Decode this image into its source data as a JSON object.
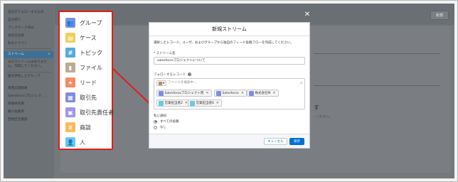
{
  "sidebar": {
    "items": [
      {
        "label": "自分がフォローするもの"
      },
      {
        "label": "自分宛て"
      },
      {
        "label": "ブックマーク済み"
      },
      {
        "label": "会社の注目"
      },
      {
        "label": "私のドラフト"
      },
      {
        "label": "ストリーム"
      },
      {
        "label": "まだストリームはありません。作成してください。"
      },
      {
        "label": "最近参照したグループ"
      },
      {
        "label": "東西応援販路"
      },
      {
        "label": "Salesforceプロジェク..."
      },
      {
        "label": "情報共有用"
      },
      {
        "label": "職人販路用"
      },
      {
        "label": "西地区営業部"
      }
    ]
  },
  "background": {
    "new_button": "新規",
    "right_text_big": "す",
    "right_text_small": "...ください。"
  },
  "callout": {
    "items": [
      {
        "label": "グループ",
        "icon": "group-icon",
        "color": "#7f8de1",
        "glyph": "👥"
      },
      {
        "label": "ケース",
        "icon": "case-icon",
        "color": "#f2cf5b",
        "glyph": "▤"
      },
      {
        "label": "トピック",
        "icon": "topic-icon",
        "color": "#56aadf",
        "glyph": "#"
      },
      {
        "label": "ファイル",
        "icon": "file-icon",
        "color": "#baac93",
        "glyph": "▮"
      },
      {
        "label": "リード",
        "icon": "lead-icon",
        "color": "#f88962",
        "glyph": "★"
      },
      {
        "label": "取引先",
        "icon": "account-icon",
        "color": "#7f8de1",
        "glyph": "▦"
      },
      {
        "label": "取引先責任者",
        "icon": "contact-icon",
        "color": "#a094ed",
        "glyph": "▣"
      },
      {
        "label": "商談",
        "icon": "opportunity-icon",
        "color": "#fcb95b",
        "glyph": "♛"
      },
      {
        "label": "人",
        "icon": "person-icon",
        "color": "#65cae4",
        "glyph": "👤"
      }
    ]
  },
  "modal": {
    "title": "新規ストリーム",
    "close": "✕",
    "description": "選択したレコード、ユーザ、およびグループから独自のフィード投稿フローを作成してください。",
    "name_label": "* ストリーム名",
    "name_value": "salesforceプロジェクトについて",
    "follow_label": "フォローするレコード",
    "info_icon": "info-icon",
    "search_placeholder": "ファイルを検索中...",
    "pills": [
      {
        "label": "Salesforceプロジェクト用",
        "icon": "group-icon",
        "color": "#7f8de1"
      },
      {
        "label": "Salesforce",
        "icon": "account-icon",
        "color": "#7f8de1"
      },
      {
        "label": "株式会社M",
        "icon": "account-icon",
        "color": "#7f8de1"
      },
      {
        "label": "営業担当者2",
        "icon": "person-icon",
        "color": "#65cae4"
      },
      {
        "label": "営業担当者6",
        "icon": "person-icon",
        "color": "#65cae4"
      }
    ],
    "notify_label": "私に通知",
    "radio_all": "すべての投稿",
    "radio_none": "なし",
    "cancel_label": "キャンセル",
    "save_label": "保存"
  },
  "colors": {
    "accent": "#e51b1b",
    "brand": "#0070d2",
    "selected_nav": "#3e6f96"
  }
}
